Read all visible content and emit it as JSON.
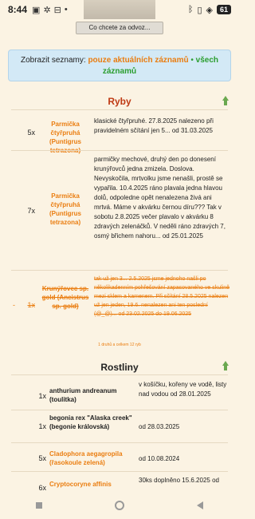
{
  "status_bar": {
    "time": "8:44",
    "battery": "61"
  },
  "top_button": "Co chcete za odvoz...",
  "filter": {
    "prefix": "Zobrazit seznamy:",
    "active_option": "pouze aktuálních záznamů",
    "separator": "•",
    "other_option": "všech záznamů"
  },
  "sections": {
    "ryby": {
      "title": "Ryby",
      "rows": [
        {
          "count": "5x",
          "name": "Parmička čtyřpruhá (Puntigrus tetrazona)",
          "desc": "klasické čtyřpruhé. 27.8.2025 nalezeno při pravidelném sčítání jen 5... od 31.03.2025"
        },
        {
          "count": "7x",
          "name": "Parmička čtyřpruhá (Puntigrus tetrazona)",
          "desc": "parmičky mechové, druhý den po donesení krunýřovců jedna zmizela. Doslova. Nevyskočila, mrtvolku jsme nenašli, prostě se vypařila. 10.4.2025 ráno plavala jedna hlavou dolů, odpoledne opět nenalezena živá ani mrtvá. Máme v akvárku černou díru??? Tak v sobotu 2.8.2025 večer plavalo v akvárku 8 zdravých zelenáčků. V neděli ráno zdravých 7, osmý břichem nahoru... od 25.01.2025"
        },
        {
          "dash": "-",
          "count": "1x",
          "name": "Krunýřovec sp. gold (Ancistrus sp. gold)",
          "desc": "tak už jen 3... 2.5.2025 jsme jednoho našli po několikadenním pohřešování zapasovaného ve skulině mezi sklem a kamenem. Při sčítání 28.5.2025 nalezen už jen jeden, 19.6. nenalezen ani ten poslední (@_@)... od 23.02.2025 do 19.06.2025"
        }
      ],
      "footnote": "1 druhů a celkem 12 ryb"
    },
    "rostliny": {
      "title": "Rostliny",
      "rows": [
        {
          "count": "1x",
          "name": "anthurium andreanum (toulitka)",
          "desc": "v košíčku, kořeny ve vodě, listy nad vodou od 28.01.2025",
          "orange": false
        },
        {
          "count": "1x",
          "name": "begonia rex \"Alaska creek\" (begonie královská)",
          "desc": "od 28.03.2025",
          "orange": false
        },
        {
          "count": "5x",
          "name": "Cladophora aegagropila (řasokoule zelená)",
          "desc": "od 10.08.2024",
          "orange": true
        },
        {
          "count": "6x",
          "name": "Cryptocoryne affinis",
          "desc": "30ks doplněno 15.6.2025 od",
          "orange": true
        }
      ]
    }
  }
}
